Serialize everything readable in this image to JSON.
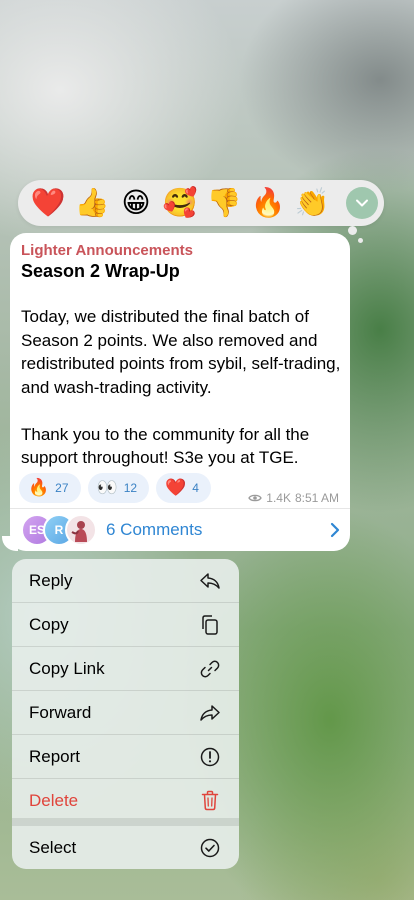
{
  "reaction_bar": {
    "emojis": [
      "❤️",
      "👍",
      "😁",
      "🥰",
      "👎",
      "🔥",
      "👏"
    ]
  },
  "message": {
    "sender": "Lighter Announcements",
    "title": "Season 2 Wrap-Up",
    "body": "Today, we distributed the final batch of Season 2 points. We also removed and redistributed points from sybil, self-trading, and wash-trading activity.\n\nThank you to the community for all the support throughout! S3e you at TGE.",
    "reactions": [
      {
        "emoji": "🔥",
        "count": "27"
      },
      {
        "emoji": "👀",
        "count": "12"
      },
      {
        "emoji": "❤️",
        "count": "4"
      }
    ],
    "views": "1.4K",
    "time": "8:51 AM",
    "comments": {
      "avatars": [
        "ES",
        "R"
      ],
      "label": "6 Comments"
    }
  },
  "menu": {
    "items": [
      {
        "label": "Reply",
        "icon": "reply-icon"
      },
      {
        "label": "Copy",
        "icon": "copy-icon"
      },
      {
        "label": "Copy Link",
        "icon": "link-icon"
      },
      {
        "label": "Forward",
        "icon": "forward-icon"
      },
      {
        "label": "Report",
        "icon": "report-icon"
      },
      {
        "label": "Delete",
        "icon": "trash-icon"
      },
      {
        "label": "Select",
        "icon": "check-circle-icon"
      }
    ]
  },
  "colors": {
    "accent": "#2f86d3",
    "sender": "#c9545a",
    "danger": "#e0443b"
  }
}
